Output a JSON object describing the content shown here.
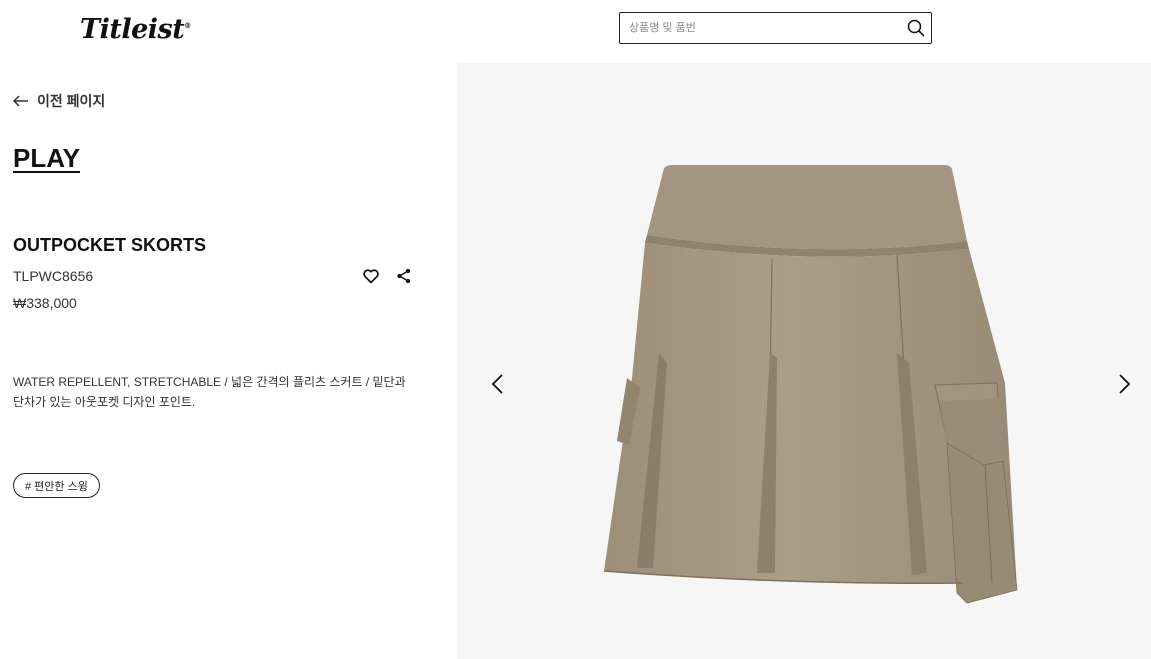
{
  "header": {
    "logo_text": "Titleist",
    "logo_mark": "®",
    "search": {
      "placeholder": "상품명 및 품번",
      "value": ""
    }
  },
  "nav": {
    "back_label": "이전 페이지"
  },
  "category": "PLAY",
  "product": {
    "name": "OUTPOCKET SKORTS",
    "code": "TLPWC8656",
    "price": "₩338,000",
    "description": "WATER REPELLENT, STRETCHABLE / 넓은 간격의 플리츠 스커트 / 밑단과 단차가 있는 아웃포켓 디자인 포인트.",
    "tags": [
      "# 편안한 스윙"
    ]
  },
  "gallery": {
    "image_subject": "khaki pleated skort with cargo pocket",
    "background_color": "#f6f6f6",
    "product_color": "#a89a85"
  },
  "icons": {
    "back": "arrow-left-icon",
    "search": "search-icon",
    "wishlist": "heart-icon",
    "share": "share-icon",
    "prev": "chevron-left-icon",
    "next": "chevron-right-icon"
  }
}
